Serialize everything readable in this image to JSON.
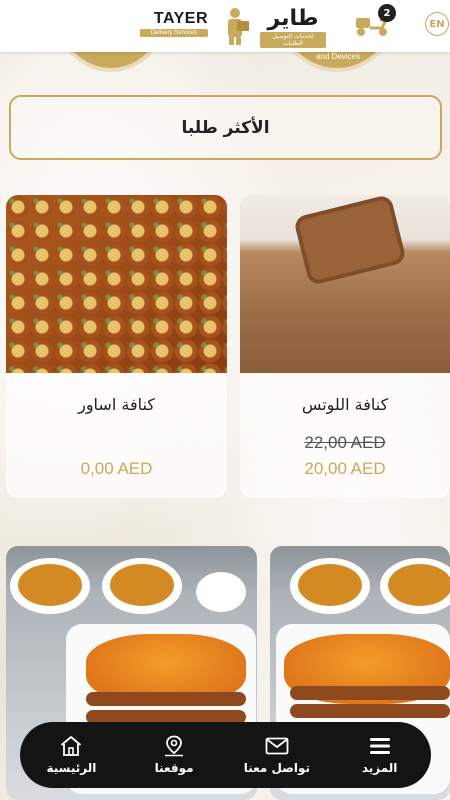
{
  "header": {
    "lang_label": "EN",
    "cart_count": "2",
    "logo_en_title": "TAYER",
    "logo_en_sub": "Delivery Services",
    "logo_ar_title": "طاير",
    "logo_ar_sub": "لخدمات التوصيل الطلبات"
  },
  "banner": {
    "right_circle_text": "and Devices"
  },
  "section": {
    "title": "الأكثر طلبا"
  },
  "products": [
    {
      "name": "كنافة اللوتس",
      "old_price": "22,00 AED",
      "price": "20,00 AED"
    },
    {
      "name": "كنافة اساور",
      "price": "0,00 AED"
    }
  ],
  "bottom_nav": [
    {
      "label": "المزيد",
      "icon": "menu-icon"
    },
    {
      "label": "تواصل معنا",
      "icon": "mail-icon"
    },
    {
      "label": "موقعنا",
      "icon": "location-pin-icon"
    },
    {
      "label": "الرئيسية",
      "icon": "home-icon"
    }
  ],
  "colors": {
    "accent": "#c9a95c",
    "nav_bg": "#141414",
    "background": "#f4efe6"
  }
}
